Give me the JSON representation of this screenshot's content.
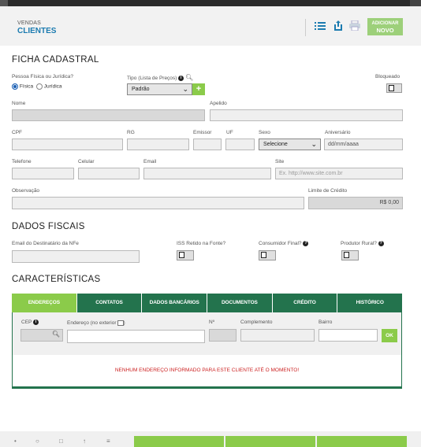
{
  "header": {
    "subtitle": "VENDAS",
    "title": "CLIENTES",
    "add_button_line1": "ADICIONAR",
    "add_button_line2": "NOVO"
  },
  "ficha": {
    "section_title": "FICHA CADASTRAL",
    "pessoa_label": "Pessoa Física ou Jurídica?",
    "fisica_label": "Física",
    "juridica_label": "Jurídica",
    "pessoa_selected": "Física",
    "tipo_label": "Tipo (Lista de Preços)",
    "tipo_value": "Padrão",
    "bloqueado_label": "Bloqueado",
    "nome_label": "Nome",
    "apelido_label": "Apelido",
    "cpf_label": "CPF",
    "rg_label": "RG",
    "emissor_label": "Emissor",
    "uf_label": "UF",
    "sexo_label": "Sexo",
    "sexo_value": "Selecione",
    "aniversario_label": "Aniversário",
    "aniversario_placeholder": "dd/mm/aaaa",
    "telefone_label": "Telefone",
    "celular_label": "Celular",
    "email_label": "Email",
    "site_label": "Site",
    "site_placeholder": "Ex. http://www.site.com.br",
    "observacao_label": "Observação",
    "limite_label": "Limite de Crédito",
    "limite_value": "R$ 0,00"
  },
  "fiscais": {
    "section_title": "DADOS FISCAIS",
    "email_nfe_label": "Email do Destinatário da NFe",
    "iss_label": "ISS Retido na Fonte?",
    "consumidor_label": "Consumidor Final?",
    "produtor_label": "Produtor Rural?"
  },
  "caracteristicas": {
    "section_title": "CARACTERÍSTICAS",
    "tabs": [
      "ENDEREÇOS",
      "CONTATOS",
      "DADOS BANCÁRIOS",
      "DOCUMENTOS",
      "CRÉDITO",
      "HISTÓRICO"
    ],
    "active_tab": "ENDEREÇOS",
    "cep_label": "CEP",
    "endereco_label": "Endereço (no exterior",
    "numero_label": "Nº",
    "complemento_label": "Complemento",
    "bairro_label": "Bairro",
    "ok_label": "OK",
    "empty_message": "NENHUM ENDEREÇO INFORMADO PARA ESTE CLIENTE ATÉ O MOMENTO!"
  },
  "colors": {
    "accent_green": "#8bcb4a",
    "dark_green": "#23734d",
    "title_blue": "#1b7bb0",
    "alert_red": "#cc2222"
  },
  "icons": [
    "list-icon",
    "export-icon",
    "print-icon",
    "search-icon",
    "plus-icon",
    "info-icon",
    "checkbox-icon"
  ]
}
